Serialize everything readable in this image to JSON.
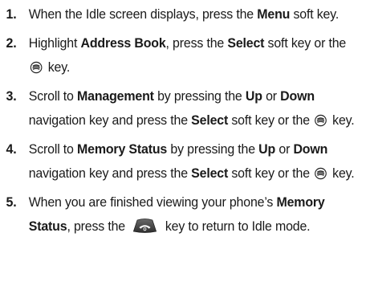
{
  "steps": [
    {
      "number": "1.",
      "t1": "When the Idle screen displays, press the ",
      "b1": "Menu",
      "t2": " soft key."
    },
    {
      "number": "2.",
      "t1": "Highlight ",
      "b1": "Address Book",
      "t2": ", press the ",
      "b2": "Select",
      "t3": " soft key or the ",
      "t4": " key."
    },
    {
      "number": "3.",
      "t1": "Scroll to ",
      "b1": "Management",
      "t2": " by pressing the ",
      "b2": "Up",
      "t3": " or ",
      "b3": "Down",
      "t4": " navigation key and press the ",
      "b4": "Select",
      "t5": " soft key or the ",
      "t6": " key."
    },
    {
      "number": "4.",
      "t1": "Scroll to ",
      "b1": "Memory Status",
      "t2": " by pressing the ",
      "b2": "Up",
      "t3": " or ",
      "b3": "Down",
      "t4": " navigation key and press the ",
      "b4": "Select",
      "t5": " soft key or the ",
      "t6": " key."
    },
    {
      "number": "5.",
      "t1": "When you are finished viewing your phone’s ",
      "b1": "Memory Status",
      "t2": ", press the ",
      "t3": " key to return to Idle mode."
    }
  ],
  "icons": {
    "select_key": "ok-key-icon",
    "end_key": "end-call-key-icon"
  }
}
